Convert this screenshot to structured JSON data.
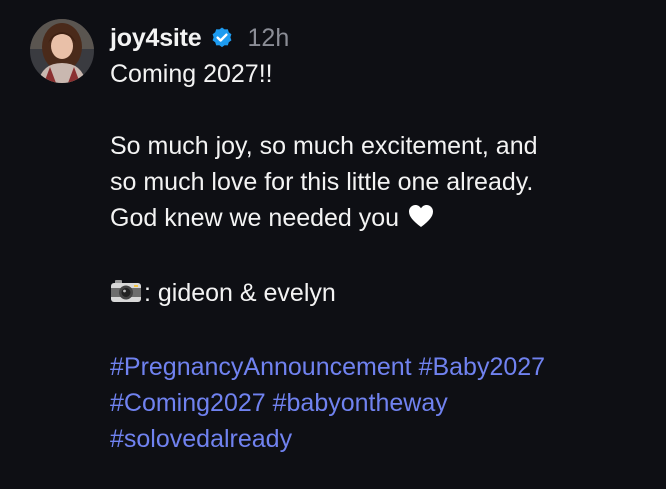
{
  "post": {
    "username": "joy4site",
    "timestamp": "12h",
    "verified_icon": "verified-badge-icon",
    "avatar_icon": "profile-avatar",
    "lines": [
      "Coming 2027!!",
      "So much joy, so much excitement, and",
      "so much love for this little one already.",
      "God knew we needed you",
      ": gideon & evelyn"
    ],
    "heart_icon": "white-heart-emoji",
    "camera_icon": "camera-emoji",
    "hashtags": [
      "#PregnancyAnnouncement",
      "#Baby2027",
      "#Coming2027",
      "#babyontheway",
      "#solovedalready"
    ]
  },
  "colors": {
    "background": "#0e0f14",
    "text": "#f3f3f3",
    "muted": "#8b8d96",
    "link": "#7082f0",
    "verified": "#1d9bf0"
  }
}
